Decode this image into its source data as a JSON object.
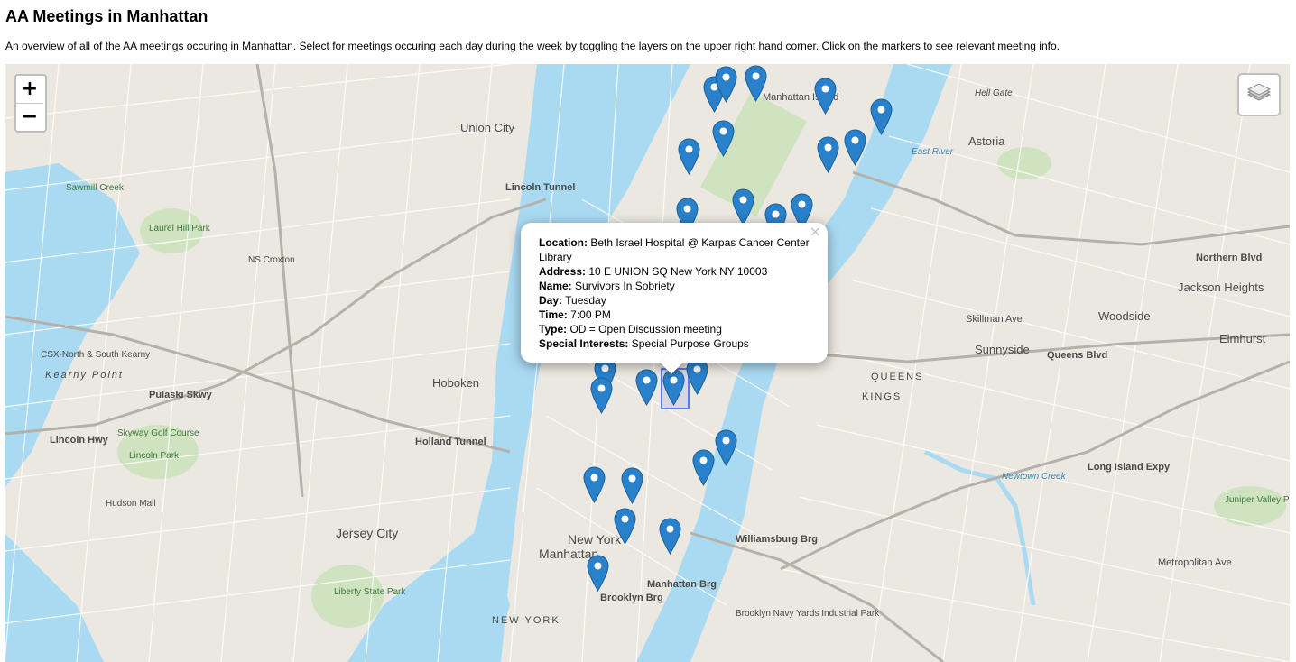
{
  "page": {
    "title": "AA Meetings in Manhattan",
    "description": "An overview of all of the AA meetings occuring in Manhattan. Select for meetings occuring each day during the week by toggling the layers on the upper right hand corner. Click on the markers to see relevant meeting info."
  },
  "map": {
    "zoom_in_label": "+",
    "zoom_out_label": "−",
    "layers_icon": "layers-icon",
    "marker_color": "#2a81cb",
    "water_color": "#aadaf2",
    "place_labels": [
      "Union City",
      "Manhattan Island",
      "Astoria",
      "Hell Gate",
      "Sawmill Creek",
      "Laurel Hill Park",
      "NS Croxton",
      "Hoboken",
      "Jersey City",
      "Kearny Point",
      "CSX-North & South Kearny",
      "Lincoln Park",
      "Skyway Golf Course",
      "Hudson Mall",
      "Liberty State Park",
      "New York",
      "Manhattan",
      "Woodside",
      "Sunnyside",
      "Jackson Heights",
      "Elmhurst",
      "Brooklyn Navy Yards Industrial Park",
      "Juniper Valley Park",
      "Metropolitan Ave",
      "Queens Blvd",
      "Long Island Expy",
      "Holland Tunnel",
      "Lincoln Tunnel",
      "Pulaski Skwy",
      "Lincoln Hwy",
      "Williamsburg Brg",
      "Manhattan Brg",
      "Brooklyn Brg",
      "QUEENS",
      "KINGS",
      "NEW YORK",
      "East River",
      "Newtown Creek",
      "Skillman Ave",
      "Northern Blvd"
    ]
  },
  "popup": {
    "close_label": "×",
    "location_label": "Location:",
    "location": "Beth Israel Hospital @ Karpas Cancer Center Library",
    "address_label": "Address:",
    "address": "10 E UNION SQ New York NY 10003",
    "name_label": "Name:",
    "name": "Survivors In Sobriety",
    "day_label": "Day:",
    "day": "Tuesday",
    "time_label": "Time:",
    "time": "7:00 PM",
    "type_label": "Type:",
    "type": "OD = Open Discussion meeting",
    "interests_label": "Special Interests:",
    "interests": "Special Purpose Groups"
  }
}
